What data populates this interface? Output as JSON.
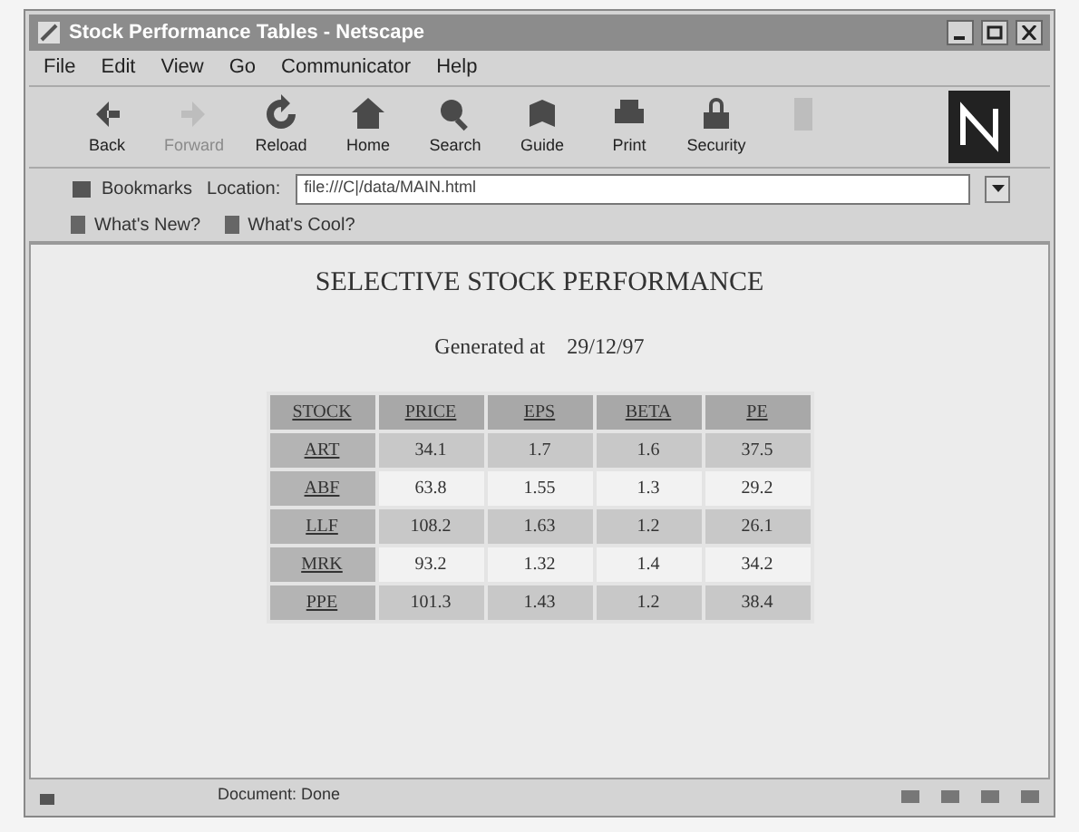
{
  "window": {
    "title": "Stock Performance Tables - Netscape"
  },
  "menu": [
    "File",
    "Edit",
    "View",
    "Go",
    "Communicator",
    "Help"
  ],
  "toolbar": [
    {
      "kind": "back",
      "label": "Back",
      "disabled": false
    },
    {
      "kind": "forward",
      "label": "Forward",
      "disabled": true
    },
    {
      "kind": "reload",
      "label": "Reload",
      "disabled": false
    },
    {
      "kind": "home",
      "label": "Home",
      "disabled": false
    },
    {
      "kind": "search",
      "label": "Search",
      "disabled": false
    },
    {
      "kind": "guide",
      "label": "Guide",
      "disabled": false
    },
    {
      "kind": "print",
      "label": "Print",
      "disabled": false
    },
    {
      "kind": "security",
      "label": "Security",
      "disabled": false
    },
    {
      "kind": "stop",
      "disabled": true
    }
  ],
  "location_bar": {
    "bookmarks": "Bookmarks",
    "label": "Location:",
    "value": "file:///C|/data/MAIN.html"
  },
  "personal_bar": [
    "What's New?",
    "What's Cool?"
  ],
  "page": {
    "heading": "SELECTIVE STOCK PERFORMANCE",
    "generated_label": "Generated at",
    "generated_date": "29/12/97",
    "table": {
      "columns": [
        "STOCK",
        "PRICE",
        "EPS",
        "BETA",
        "PE"
      ],
      "rows": [
        [
          "ART",
          "34.1",
          "1.7",
          "1.6",
          "37.5"
        ],
        [
          "ABF",
          "63.8",
          "1.55",
          "1.3",
          "29.2"
        ],
        [
          "LLF",
          "108.2",
          "1.63",
          "1.2",
          "26.1"
        ],
        [
          "MRK",
          "93.2",
          "1.32",
          "1.4",
          "34.2"
        ],
        [
          "PPE",
          "101.3",
          "1.43",
          "1.2",
          "38.4"
        ]
      ]
    }
  },
  "status_bar": {
    "text": "Document: Done"
  }
}
